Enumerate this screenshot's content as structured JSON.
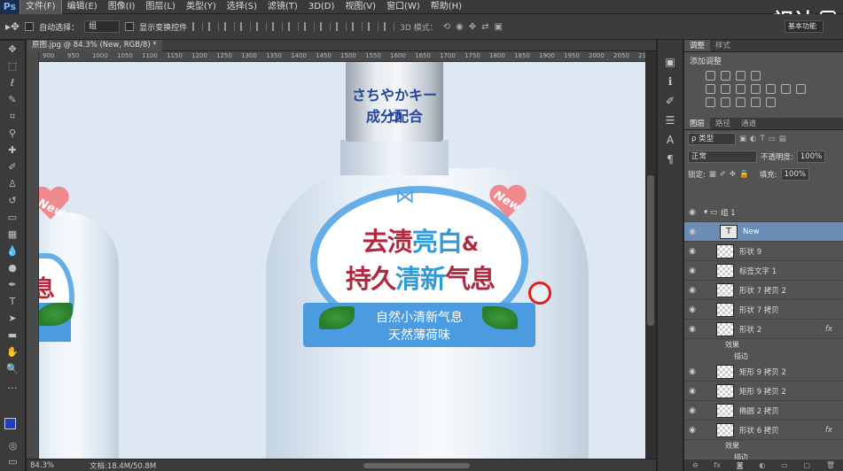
{
  "app": {
    "logo": "Ps"
  },
  "menu": [
    "文件(F)",
    "编辑(E)",
    "图像(I)",
    "图层(L)",
    "类型(Y)",
    "选择(S)",
    "滤镜(T)",
    "3D(D)",
    "视图(V)",
    "窗口(W)",
    "帮助(H)"
  ],
  "watermark": "视达",
  "options": {
    "auto_select_label": "自动选择：",
    "auto_select_value": "组",
    "show_transform_label": "显示变换控件",
    "mode_3d": "3D 模式：",
    "workspace": "基本功能"
  },
  "document": {
    "tab_title": "原图.jpg @ 84.3% (New, RGB/8) *",
    "zoom": "84.3%",
    "doc_size": "文档:18.4M/50.8M"
  },
  "ruler_ticks": [
    "900",
    "950",
    "1000",
    "1050",
    "1100",
    "1150",
    "1200",
    "1250",
    "1300",
    "1350",
    "1400",
    "1450",
    "1500",
    "1550",
    "1600",
    "1650",
    "1700",
    "1750",
    "1800",
    "1850",
    "1900",
    "1950",
    "2000",
    "2050",
    "2100"
  ],
  "artwork": {
    "cap_line1": "さちやかキーつ",
    "cap_line2": "成分配合",
    "title_line1": {
      "a": "去渍",
      "b": "亮白",
      "c": "&"
    },
    "title_line2": {
      "a": "持久",
      "b": "清新",
      "c": "气息"
    },
    "banner_line1": "自然小清新气息",
    "banner_line2": "天然薄荷味",
    "new_tag": "New",
    "left_partial_text": "息"
  },
  "panels": {
    "top_tabs": [
      "调整",
      "样式"
    ],
    "adjust_title": "添加调整",
    "layer_tabs": [
      "图层",
      "路径",
      "通道"
    ],
    "kind_filter": "ρ 类型",
    "blend_mode": "正常",
    "opacity_label": "不透明度:",
    "opacity_value": "100%",
    "lock_label": "锁定:",
    "fill_label": "填充:",
    "fill_value": "100%"
  },
  "layers": [
    {
      "name": "组 1",
      "type": "group"
    },
    {
      "name": "New",
      "type": "text",
      "selected": true
    },
    {
      "name": "形状 9",
      "type": "shape"
    },
    {
      "name": "标签文字 1",
      "type": "shape"
    },
    {
      "name": "形状 7 拷贝 2",
      "type": "shape"
    },
    {
      "name": "形状 7 拷贝",
      "type": "shape"
    },
    {
      "name": "形状 2",
      "type": "shape",
      "fx": true
    },
    {
      "name": "效果",
      "type": "effect"
    },
    {
      "name": "描边",
      "type": "effect"
    },
    {
      "name": "矩形 9 拷贝 2",
      "type": "shape"
    },
    {
      "name": "矩形 9 拷贝 2",
      "type": "shape"
    },
    {
      "name": "椭圆 2 拷贝",
      "type": "shape"
    },
    {
      "name": "形状 6 拷贝",
      "type": "shape",
      "fx": true
    },
    {
      "name": "效果",
      "type": "effect"
    },
    {
      "name": "描边",
      "type": "effect"
    }
  ]
}
